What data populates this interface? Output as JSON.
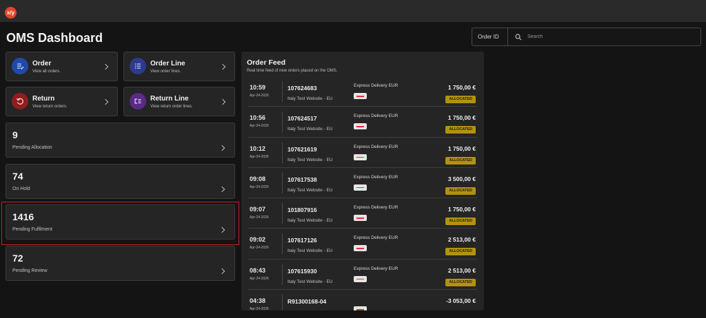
{
  "app": {
    "logo_text": "x/y",
    "title": "OMS Dashboard"
  },
  "search": {
    "field_label": "Order ID",
    "placeholder": "Search"
  },
  "nav_cards": [
    {
      "title": "Order",
      "subtitle": "View all orders.",
      "icon": "order-list-icon",
      "color": "#1f4aa8"
    },
    {
      "title": "Order Line",
      "subtitle": "View order lines.",
      "icon": "list-icon",
      "color": "#2d3a8e"
    },
    {
      "title": "Return",
      "subtitle": "View return orders.",
      "icon": "return-icon",
      "color": "#8e1e1e"
    },
    {
      "title": "Return Line",
      "subtitle": "View return order lines.",
      "icon": "return-line-icon",
      "color": "#5a2a86"
    }
  ],
  "stats": [
    {
      "value": "9",
      "label": "Pending Allocation"
    },
    {
      "value": "74",
      "label": "On Hold"
    },
    {
      "value": "1416",
      "label": "Pending Fulfilment"
    },
    {
      "value": "72",
      "label": "Pending Review"
    }
  ],
  "feed": {
    "title": "Order Feed",
    "subtitle": "Real time feed of new orders placed on the OMS.",
    "rows": [
      {
        "time": "10:59",
        "date": "Apr-24-2026",
        "number": "107624683",
        "site": "Italy Test Website - EU",
        "shipping": "Express Delivery EUR",
        "amount": "1 750,00 €",
        "status": "ALLOCATED"
      },
      {
        "time": "10:56",
        "date": "Apr-24-2026",
        "number": "107624517",
        "site": "Italy Test Website - EU",
        "shipping": "Express Delivery EUR",
        "amount": "1 750,00 €",
        "status": "ALLOCATED"
      },
      {
        "time": "10:12",
        "date": "Apr-24-2026",
        "number": "107621619",
        "site": "Italy Test Website - EU",
        "shipping": "Express Delivery EUR",
        "amount": "1 750,00 €",
        "status": "ALLOCATED"
      },
      {
        "time": "09:08",
        "date": "Apr-24-2026",
        "number": "107617538",
        "site": "Italy Test Website - EU",
        "shipping": "Express Delivery EUR",
        "amount": "3 500,00 €",
        "status": "ALLOCATED"
      },
      {
        "time": "09:07",
        "date": "Apr-24-2026",
        "number": "101807916",
        "site": "Italy Test Website - EU",
        "shipping": "Express Delivery EUR",
        "amount": "1 750,00 €",
        "status": "ALLOCATED"
      },
      {
        "time": "09:02",
        "date": "Apr-24-2026",
        "number": "107617126",
        "site": "Italy Test Website - EU",
        "shipping": "Express Delivery EUR",
        "amount": "2 513,00 €",
        "status": "ALLOCATED"
      },
      {
        "time": "08:43",
        "date": "Apr-24-2026",
        "number": "107615930",
        "site": "Italy Test Website - EU",
        "shipping": "Express Delivery EUR",
        "amount": "2 513,00 €",
        "status": "ALLOCATED"
      },
      {
        "time": "04:38",
        "date": "Apr-24-2026",
        "number": "R91300168-04",
        "site": "",
        "shipping": "",
        "amount": "-3 053,00 €",
        "status": ""
      }
    ]
  }
}
